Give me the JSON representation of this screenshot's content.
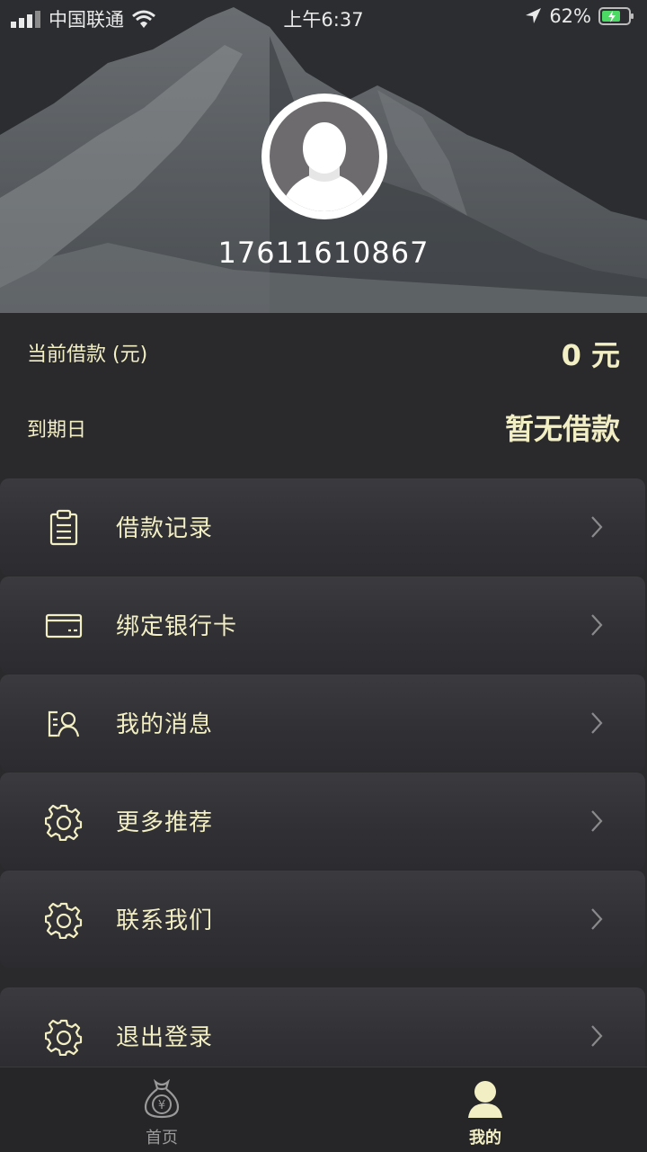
{
  "status_bar": {
    "carrier": "中国联通",
    "time": "上午6:37",
    "battery": "62%"
  },
  "profile": {
    "phone": "17611610867"
  },
  "loan": {
    "current_label": "当前借款 (元)",
    "current_value": "0 元",
    "due_label": "到期日",
    "due_value": "暂无借款"
  },
  "menu": [
    {
      "label": "借款记录",
      "icon": "clipboard-icon"
    },
    {
      "label": "绑定银行卡",
      "icon": "bank-card-icon"
    },
    {
      "label": "我的消息",
      "icon": "message-contact-icon"
    },
    {
      "label": "更多推荐",
      "icon": "gear-icon"
    },
    {
      "label": "联系我们",
      "icon": "gear-icon"
    },
    {
      "label": "退出登录",
      "icon": "gear-icon"
    }
  ],
  "tabbar": {
    "tabs": [
      {
        "label": "首页",
        "icon": "money-bag-icon",
        "active": false
      },
      {
        "label": "我的",
        "icon": "user-icon",
        "active": true
      }
    ]
  },
  "colors": {
    "accent": "#f3efc4",
    "background": "#2a2a2d",
    "inactive_tab": "#9a9a9a"
  }
}
